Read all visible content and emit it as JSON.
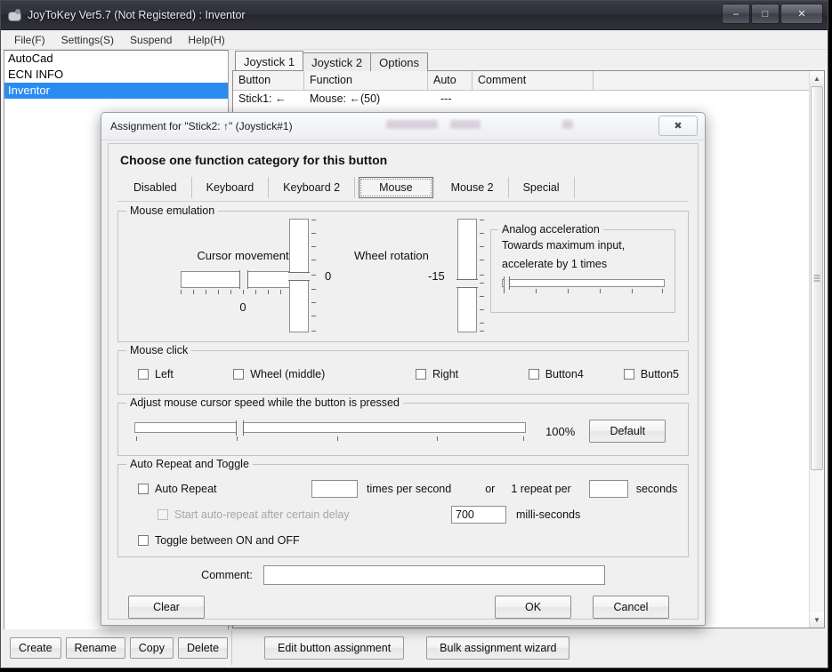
{
  "window": {
    "title": "JoyToKey Ver5.7 (Not Registered) : Inventor",
    "icon": "joystick-icon",
    "controls": {
      "minimize": "–",
      "maximize": "□",
      "close": "✕"
    }
  },
  "menu": {
    "items": [
      "File(F)",
      "Settings(S)",
      "Suspend",
      "Help(H)"
    ]
  },
  "profiles": {
    "items": [
      {
        "label": "AutoCad",
        "selected": false
      },
      {
        "label": "ECN INFO",
        "selected": false
      },
      {
        "label": "Inventor",
        "selected": true
      }
    ]
  },
  "tabs": {
    "items": [
      "Joystick 1",
      "Joystick 2",
      "Options"
    ],
    "active": "Joystick 1"
  },
  "grid": {
    "columns": [
      "Button",
      "Function",
      "Auto",
      "Comment",
      ""
    ],
    "rows": [
      {
        "button": "Stick1: ←",
        "function": "Mouse: ←(50)",
        "auto": "---",
        "comment": ""
      }
    ]
  },
  "bottom_toolbar": {
    "left_buttons": [
      "Create",
      "Rename",
      "Copy",
      "Delete"
    ],
    "right_buttons": [
      "Edit button assignment",
      "Bulk assignment wizard"
    ]
  },
  "dialog": {
    "title": "Assignment for \"Stick2: ↑\" (Joystick#1)",
    "close_label": "✖",
    "heading": "Choose one function category for this button",
    "category_tabs": {
      "items": [
        "Disabled",
        "Keyboard",
        "Keyboard 2",
        "Mouse",
        "Mouse 2",
        "Special"
      ],
      "selected": "Mouse"
    },
    "mouse_emulation": {
      "legend": "Mouse emulation",
      "cursor_movement": {
        "label": "Cursor movement",
        "horizontal_value": "0",
        "vertical_value": "0"
      },
      "wheel_rotation": {
        "label": "Wheel rotation",
        "value": "-15"
      },
      "analog_acceleration": {
        "legend": "Analog acceleration",
        "line1": "Towards maximum input,",
        "line2": "accelerate by 1 times"
      }
    },
    "mouse_click": {
      "legend": "Mouse click",
      "options": [
        {
          "label": "Left",
          "checked": false
        },
        {
          "label": "Wheel (middle)",
          "checked": false
        },
        {
          "label": "Right",
          "checked": false
        },
        {
          "label": "Button4",
          "checked": false
        },
        {
          "label": "Button5",
          "checked": false
        }
      ]
    },
    "cursor_speed": {
      "legend": "Adjust mouse cursor speed while the button is pressed",
      "percent": "100%",
      "default_button": "Default"
    },
    "auto_repeat": {
      "legend": "Auto Repeat and Toggle",
      "auto_repeat_label": "Auto Repeat",
      "auto_repeat_checked": false,
      "times_value": "",
      "times_label": "times per second",
      "or_label": "or",
      "one_repeat_label": "1 repeat per",
      "seconds_value": "",
      "seconds_label": "seconds",
      "delay_label": "Start auto-repeat after certain delay",
      "delay_checked": false,
      "delay_value": "700",
      "delay_unit": "milli-seconds",
      "toggle_label": "Toggle between ON and OFF",
      "toggle_checked": false
    },
    "comment": {
      "label": "Comment:",
      "value": ""
    },
    "buttons": {
      "clear": "Clear",
      "ok": "OK",
      "cancel": "Cancel"
    }
  },
  "colors": {
    "selection": "#2a8cf0",
    "window_bg": "#f0f0f0",
    "titlebar": "#2f2f3a"
  }
}
